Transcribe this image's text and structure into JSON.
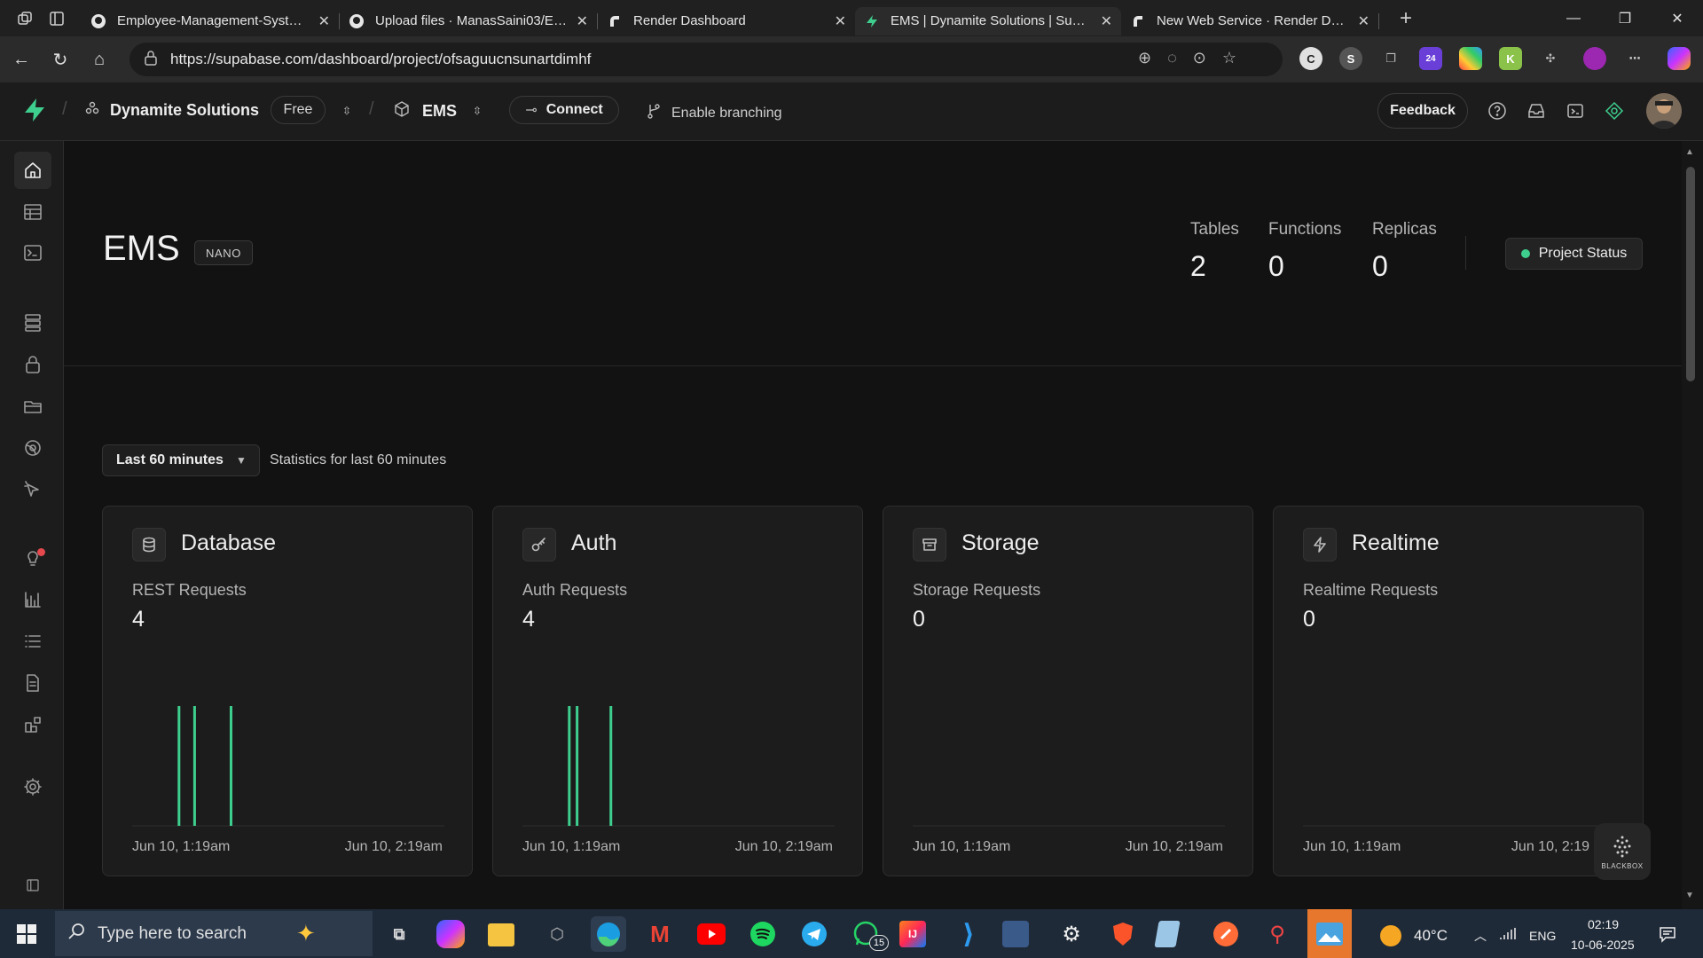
{
  "browser": {
    "tabs": [
      {
        "title": "Employee-Management-System/f",
        "icon": "github-icon"
      },
      {
        "title": "Upload files · ManasSaini03/Empl",
        "icon": "github-icon"
      },
      {
        "title": "Render Dashboard",
        "icon": "render-icon"
      },
      {
        "title": "EMS | Dynamite Solutions | Supab",
        "icon": "supabase-icon",
        "active": true
      },
      {
        "title": "New Web Service · Render Dashb",
        "icon": "render-icon"
      }
    ],
    "url": "https://supabase.com/dashboard/project/ofsaguucnsunartdimhf",
    "extension_badge": "24"
  },
  "header": {
    "org": "Dynamite Solutions",
    "plan": "Free",
    "project": "EMS",
    "connect_label": "Connect",
    "branching_label": "Enable branching",
    "feedback_label": "Feedback"
  },
  "project": {
    "title": "EMS",
    "compute_badge": "NANO",
    "stats": [
      {
        "label": "Tables",
        "value": "2"
      },
      {
        "label": "Functions",
        "value": "0"
      },
      {
        "label": "Replicas",
        "value": "0"
      }
    ],
    "status_label": "Project Status"
  },
  "range": {
    "selected": "Last 60 minutes",
    "description": "Statistics for last 60 minutes"
  },
  "cards": [
    {
      "title": "Database",
      "metric_label": "REST Requests",
      "metric_value": "4",
      "x_start": "Jun 10, 1:19am",
      "x_end": "Jun 10, 2:19am",
      "icon": "database-icon"
    },
    {
      "title": "Auth",
      "metric_label": "Auth Requests",
      "metric_value": "4",
      "x_start": "Jun 10, 1:19am",
      "x_end": "Jun 10, 2:19am",
      "icon": "key-icon"
    },
    {
      "title": "Storage",
      "metric_label": "Storage Requests",
      "metric_value": "0",
      "x_start": "Jun 10, 1:19am",
      "x_end": "Jun 10, 2:19am",
      "icon": "archive-icon"
    },
    {
      "title": "Realtime",
      "metric_label": "Realtime Requests",
      "metric_value": "0",
      "x_start": "Jun 10, 1:19am",
      "x_end": "Jun 10, 2:19",
      "icon": "lightning-icon"
    }
  ],
  "chart_data": [
    {
      "type": "bar",
      "title": "REST Requests",
      "x_range": [
        "Jun 10, 1:19am",
        "Jun 10, 2:19am"
      ],
      "x": [
        9,
        12,
        19
      ],
      "values": [
        1,
        1,
        1
      ],
      "xlim": [
        0,
        60
      ],
      "ylim": [
        0,
        1
      ],
      "grid": false
    },
    {
      "type": "bar",
      "title": "Auth Requests",
      "x_range": [
        "Jun 10, 1:19am",
        "Jun 10, 2:19am"
      ],
      "x": [
        9,
        10.5,
        17
      ],
      "values": [
        1,
        1,
        1
      ],
      "xlim": [
        0,
        60
      ],
      "ylim": [
        0,
        1
      ],
      "grid": false
    },
    {
      "type": "bar",
      "title": "Storage Requests",
      "x_range": [
        "Jun 10, 1:19am",
        "Jun 10, 2:19am"
      ],
      "x": [],
      "values": [],
      "xlim": [
        0,
        60
      ],
      "ylim": [
        0,
        1
      ],
      "grid": false
    },
    {
      "type": "bar",
      "title": "Realtime Requests",
      "x_range": [
        "Jun 10, 1:19am",
        "Jun 10, 2:19"
      ],
      "x": [],
      "values": [],
      "xlim": [
        0,
        60
      ],
      "ylim": [
        0,
        1
      ],
      "grid": false
    }
  ],
  "colors": {
    "accent": "#3ecf8e",
    "background": "#121212",
    "panel": "#1c1c1c",
    "taskbar": "#1f2a38"
  },
  "overlay": {
    "label": "BLACKBOX"
  },
  "taskbar": {
    "search_placeholder": "Type here to search",
    "whatsapp_badge": "15",
    "weather": "40°C",
    "language": "ENG",
    "time": "02:19",
    "date": "10-06-2025"
  }
}
